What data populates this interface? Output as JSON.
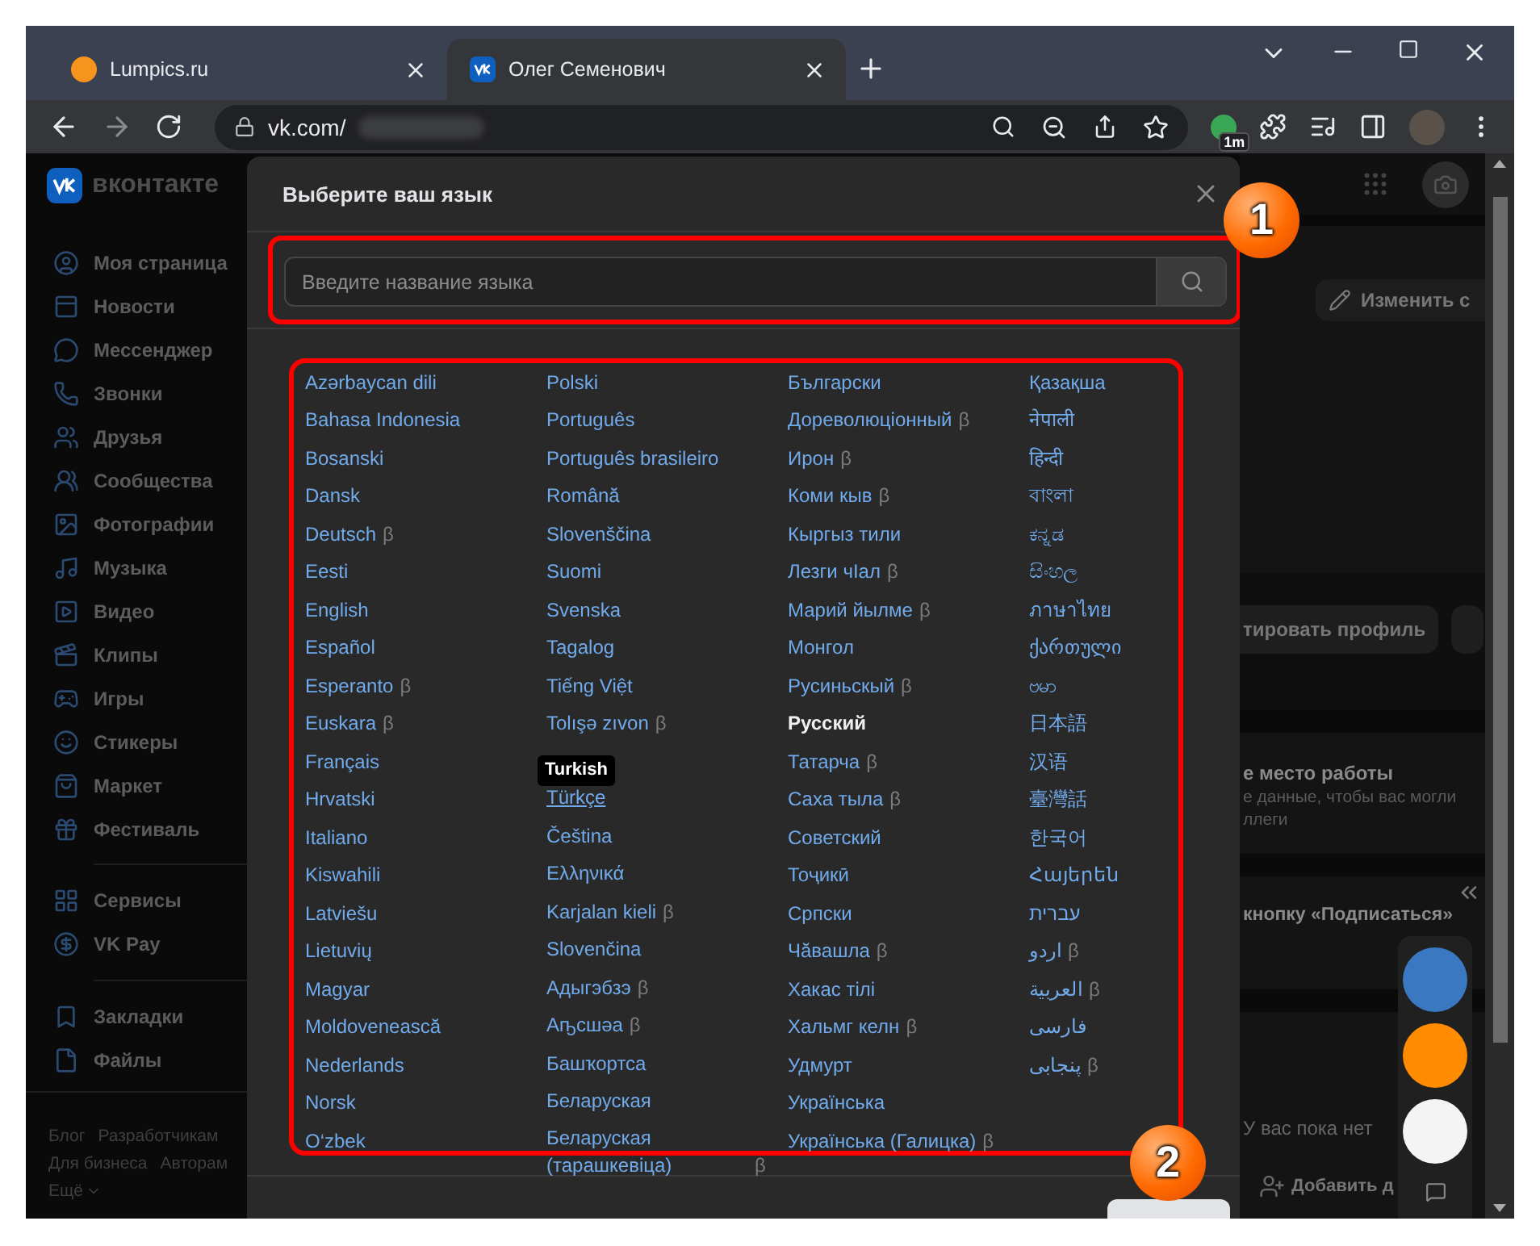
{
  "browser": {
    "tabs": [
      {
        "title": "Lumpics.ru",
        "selected": false
      },
      {
        "title": "Олег Семенович",
        "selected": true
      }
    ],
    "address": "vk.com/",
    "extension_badge": "1m"
  },
  "sidebar": {
    "logo": "вконтакте",
    "sections": [
      [
        "Моя страница",
        "Новости",
        "Мессенджер",
        "Звонки",
        "Друзья",
        "Сообщества",
        "Фотографии",
        "Музыка",
        "Видео",
        "Клипы",
        "Игры",
        "Стикеры",
        "Маркет",
        "Фестиваль"
      ],
      [
        "Сервисы",
        "VK Pay"
      ],
      [
        "Закладки",
        "Файлы"
      ]
    ],
    "footer": [
      [
        "Блог",
        "Разработчикам"
      ],
      [
        "Для бизнеса",
        "Авторам"
      ]
    ],
    "more": "Ещё"
  },
  "modal": {
    "title": "Выберите ваш язык",
    "search": {
      "placeholder": "Введите название языка"
    },
    "columns": [
      [
        {
          "label": "Azərbaycan dili",
          "selected": false
        },
        {
          "label": "Bahasa Indonesia",
          "selected": false
        },
        {
          "label": "Bosanski",
          "selected": false
        },
        {
          "label": "Dansk",
          "selected": false
        },
        {
          "label": "Deutsch",
          "badge": "β",
          "selected": false
        },
        {
          "label": "Eesti",
          "selected": false
        },
        {
          "label": "English",
          "selected": false
        },
        {
          "label": "Español",
          "selected": false
        },
        {
          "label": "Esperanto",
          "badge": "β",
          "selected": false
        },
        {
          "label": "Euskara",
          "badge": "β",
          "selected": false
        },
        {
          "label": "Français",
          "selected": false
        },
        {
          "label": "Hrvatski",
          "selected": false
        },
        {
          "label": "Italiano",
          "selected": false
        },
        {
          "label": "Kiswahili",
          "selected": false
        },
        {
          "label": "Latviešu",
          "selected": false
        },
        {
          "label": "Lietuvių",
          "selected": false
        },
        {
          "label": "Magyar",
          "selected": false
        },
        {
          "label": "Moldovenească",
          "selected": false
        },
        {
          "label": "Nederlands",
          "selected": false
        },
        {
          "label": "Norsk",
          "selected": false
        },
        {
          "label": "O‘zbek",
          "selected": false
        }
      ],
      [
        {
          "label": "Polski",
          "selected": false
        },
        {
          "label": "Português",
          "selected": false
        },
        {
          "label": "Português brasileiro",
          "selected": false
        },
        {
          "label": "Română",
          "selected": false
        },
        {
          "label": "Slovenščina",
          "selected": false
        },
        {
          "label": "Suomi",
          "selected": false
        },
        {
          "label": "Svenska",
          "selected": false
        },
        {
          "label": "Tagalog",
          "selected": false
        },
        {
          "label": "Tiếng Việt",
          "selected": false
        },
        {
          "label": "Tolışə zıvon",
          "badge": "β",
          "selected": false
        },
        {
          "label": "Türkçe",
          "tooltip": "Turkish",
          "selected": false
        },
        {
          "label": "Čeština",
          "selected": false
        },
        {
          "label": "Ελληνικά",
          "selected": false
        },
        {
          "label": "Karjalan kieli",
          "badge": "β",
          "selected": false
        },
        {
          "label": "Slovenčina",
          "selected": false
        },
        {
          "label": "Адыгэбзэ",
          "badge": "β",
          "selected": false
        },
        {
          "label": "Аҧсшәа",
          "badge": "β",
          "selected": false
        },
        {
          "label": "Башҡортса",
          "selected": false
        },
        {
          "label": "Беларуская",
          "selected": false
        },
        {
          "label": "Беларуская (тарашкевіца)",
          "badge": "β",
          "selected": false
        }
      ],
      [
        {
          "label": "Български",
          "selected": false
        },
        {
          "label": "Дореволюціонный",
          "badge": "β",
          "selected": false
        },
        {
          "label": "Ирон",
          "badge": "β",
          "selected": false
        },
        {
          "label": "Коми кыв",
          "badge": "β",
          "selected": false
        },
        {
          "label": "Кыргыз тили",
          "selected": false
        },
        {
          "label": "Лезги чӀал",
          "badge": "β",
          "selected": false
        },
        {
          "label": "Марий йылме",
          "badge": "β",
          "selected": false
        },
        {
          "label": "Монгол",
          "selected": false
        },
        {
          "label": "Русиньскый",
          "badge": "β",
          "selected": false
        },
        {
          "label": "Русский",
          "selected": true
        },
        {
          "label": "Татарча",
          "badge": "β",
          "selected": false
        },
        {
          "label": "Саха тыла",
          "badge": "β",
          "selected": false
        },
        {
          "label": "Советский",
          "selected": false
        },
        {
          "label": "Тоҷикӣ",
          "selected": false
        },
        {
          "label": "Српски",
          "selected": false
        },
        {
          "label": "Чӑвашла",
          "badge": "β",
          "selected": false
        },
        {
          "label": "Хакас тілі",
          "selected": false
        },
        {
          "label": "Хальмг келн",
          "badge": "β",
          "selected": false
        },
        {
          "label": "Удмурт",
          "selected": false
        },
        {
          "label": "Українська",
          "selected": false
        },
        {
          "label": "Українська (Галицка)",
          "badge": "β",
          "selected": false
        }
      ],
      [
        {
          "label": "Қазақша",
          "selected": false
        },
        {
          "label": "नेपाली",
          "selected": false
        },
        {
          "label": "हिन्दी",
          "selected": false
        },
        {
          "label": "বাংলা",
          "selected": false
        },
        {
          "label": "ಕನ್ನಡ",
          "selected": false
        },
        {
          "label": "සිංහල",
          "selected": false
        },
        {
          "label": "ภาษาไทย",
          "selected": false
        },
        {
          "label": "ქართული",
          "selected": false
        },
        {
          "label": "ဗမာ",
          "selected": false
        },
        {
          "label": "日本語",
          "selected": false
        },
        {
          "label": "汉语",
          "selected": false
        },
        {
          "label": "臺灣話",
          "selected": false
        },
        {
          "label": "한국어",
          "selected": false
        },
        {
          "label": "Հայերեն",
          "selected": false
        },
        {
          "label": "עברית",
          "selected": false
        },
        {
          "label": "اردو",
          "badge": "β",
          "selected": false
        },
        {
          "label": "العربية",
          "badge": "β",
          "selected": false
        },
        {
          "label": "فارسی",
          "selected": false
        },
        {
          "label": "پنجابی",
          "badge": "β",
          "selected": false
        }
      ]
    ]
  },
  "annotations": [
    "1",
    "2"
  ],
  "background_page": {
    "edit_button": "Изменить с",
    "profile_button": "тировать профиль",
    "work_title": "е место работы",
    "work_text": "е данные, чтобы вас могли",
    "work_text_2": "ллеги",
    "subscribe_text": "кнопку «Подписаться»",
    "empty_text": "У вас пока нет",
    "add_button": "Добавить д"
  }
}
